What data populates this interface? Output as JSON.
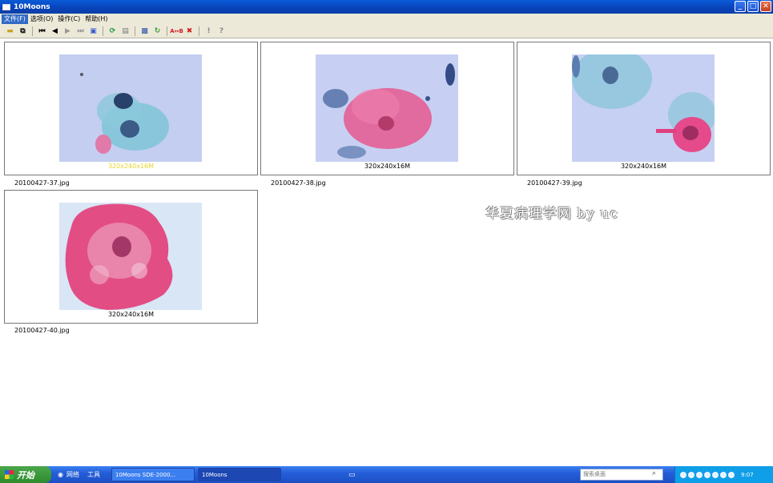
{
  "window": {
    "title": "10Moons"
  },
  "menu": [
    {
      "label": "文件(F)",
      "active": true
    },
    {
      "label": "选项(O)"
    },
    {
      "label": "操作(C)"
    },
    {
      "label": "帮助(H)"
    }
  ],
  "toolbar": [
    "open-icon",
    "copy-icon",
    "first-icon",
    "prev-icon",
    "next-icon",
    "last-icon",
    "slideshow-icon",
    "refresh-icon",
    "film-icon",
    "photo-icon",
    "rotate-icon",
    "compare-icon",
    "delete-icon",
    "info-icon",
    "help-icon"
  ],
  "thumbnails": [
    {
      "dims": "320x240x16M",
      "filename": "20100427-37.jpg"
    },
    {
      "dims": "320x240x16M",
      "filename": "20100427-38.jpg"
    },
    {
      "dims": "320x240x16M",
      "filename": "20100427-39.jpg"
    },
    {
      "dims": "320x240x16M",
      "filename": "20100427-40.jpg"
    }
  ],
  "watermark": "华夏病理学网 by uc",
  "taskbar": {
    "start": "开始",
    "quick": [
      "网络",
      "工具"
    ],
    "tasks": [
      "10Moons SDE-2000...",
      "10Moons"
    ],
    "search_placeholder": "搜索桌面",
    "clock": "9:07"
  }
}
